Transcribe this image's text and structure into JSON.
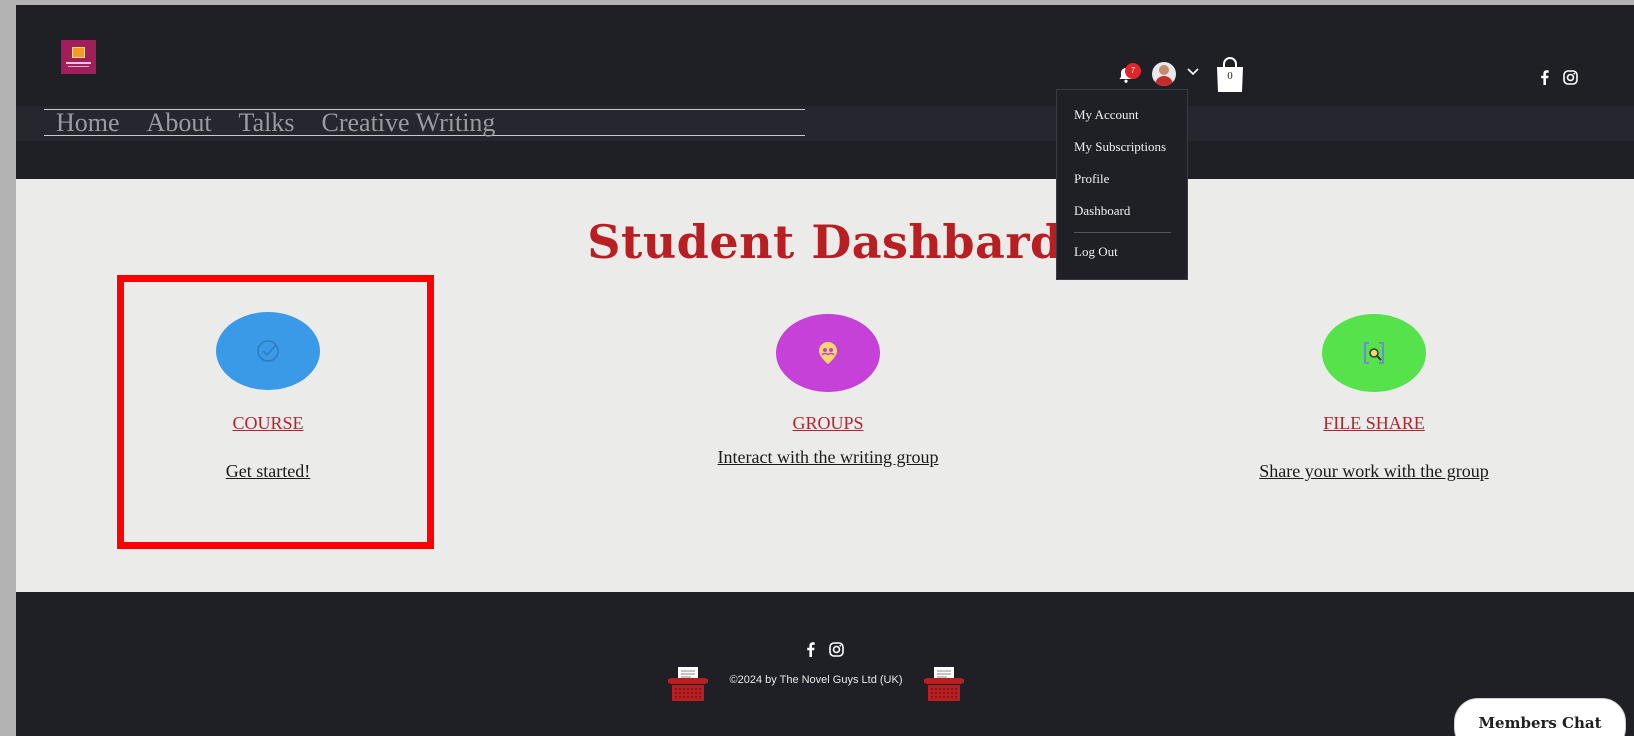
{
  "nav": {
    "items": [
      {
        "label": "Home"
      },
      {
        "label": "About"
      },
      {
        "label": "Talks"
      },
      {
        "label": "Creative Writing"
      }
    ]
  },
  "member": {
    "notification_count": "7",
    "cart_count": "0",
    "dropdown": {
      "items": [
        {
          "label": "My Account"
        },
        {
          "label": "My Subscriptions"
        },
        {
          "label": "Profile"
        },
        {
          "label": "Dashboard"
        }
      ],
      "logout_label": "Log Out"
    }
  },
  "dashboard": {
    "title": "Student Dashbard",
    "cards": [
      {
        "title": "COURSE",
        "link": "Get started!",
        "color": "#3b9ae8",
        "icon": "check-circle-icon"
      },
      {
        "title": "GROUPS",
        "link": "Interact with the writing group",
        "color": "#c641d8",
        "icon": "group-pin-icon"
      },
      {
        "title": "FILE SHARE",
        "link": "Share your work with the group",
        "color": "#56e24a",
        "icon": "file-search-icon"
      }
    ]
  },
  "footer": {
    "copyright": "©2024 by The Novel Guys Ltd (UK)"
  },
  "chat": {
    "label": "Members Chat"
  },
  "colors": {
    "background": "#1f2026",
    "accent_red": "#b81f22",
    "highlight": "#ff0000"
  }
}
